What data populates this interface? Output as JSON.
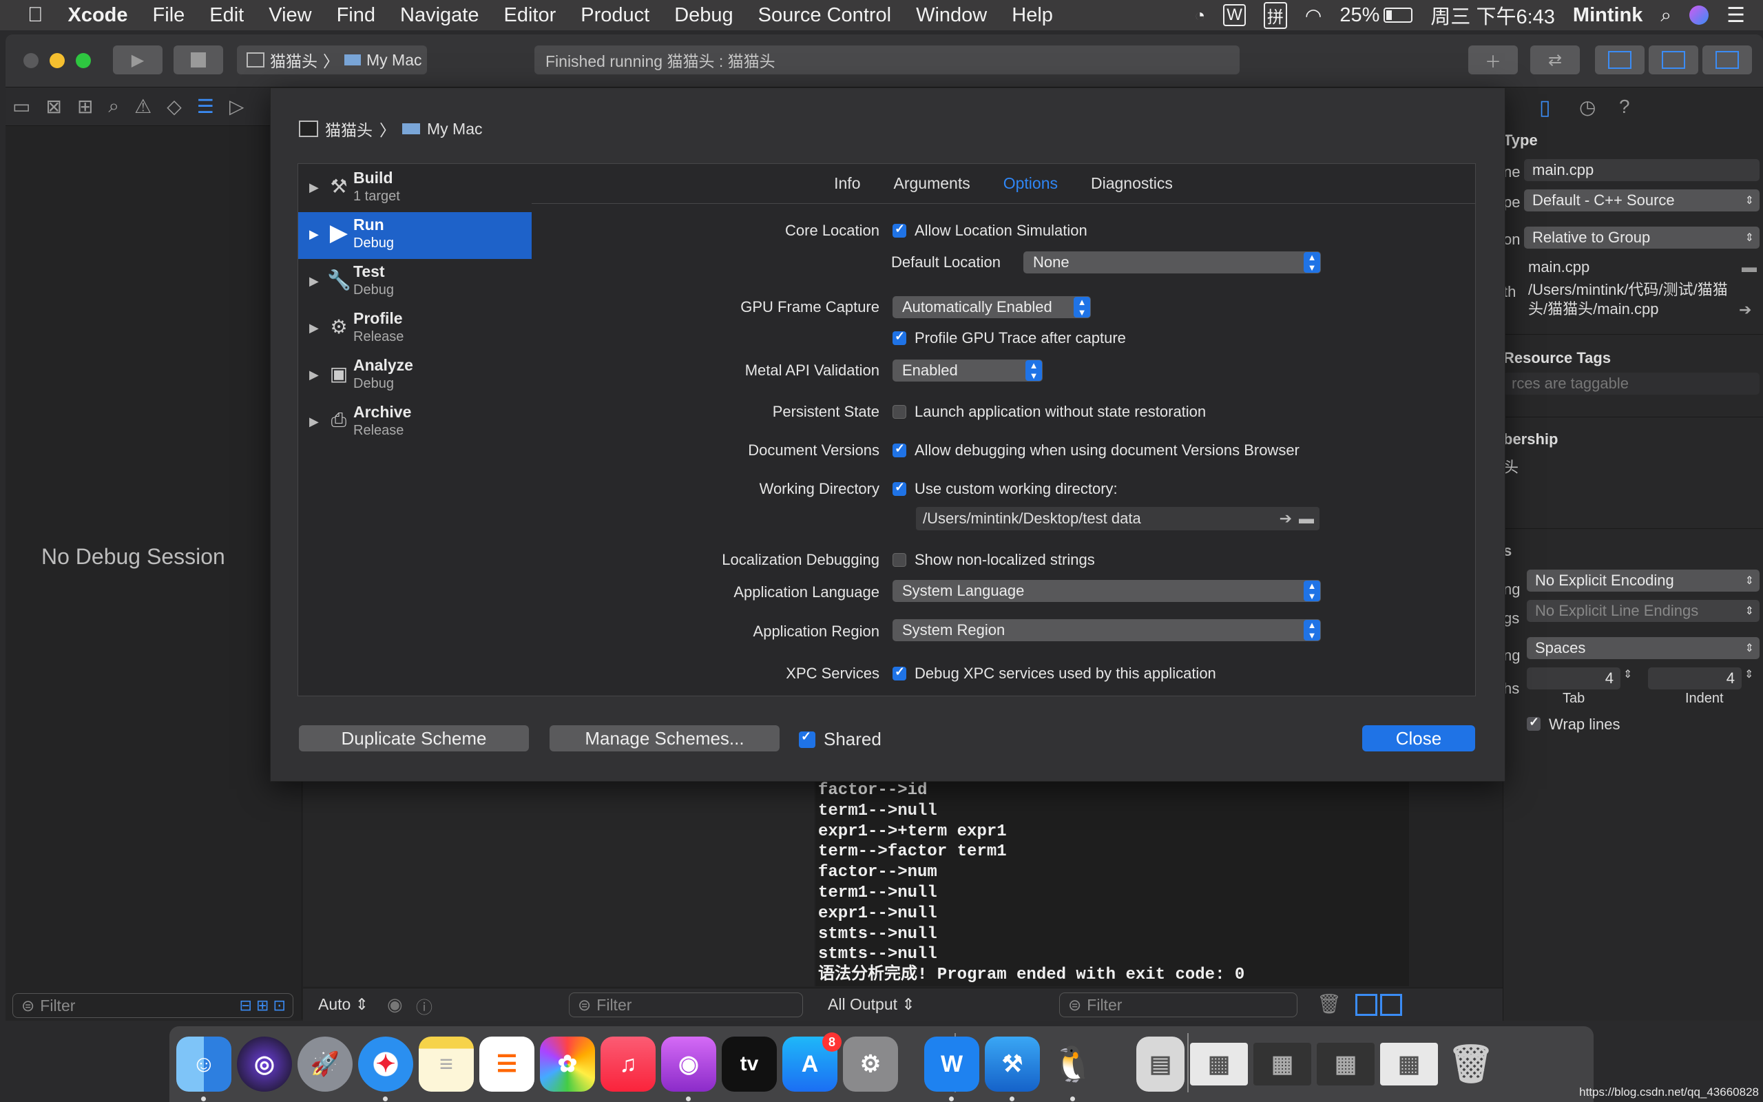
{
  "menubar": {
    "apple_icon": "apple-icon",
    "items": [
      "Xcode",
      "File",
      "Edit",
      "View",
      "Find",
      "Navigate",
      "Editor",
      "Product",
      "Debug",
      "Source Control",
      "Window",
      "Help"
    ],
    "battery": "25%",
    "clock": "周三 下午6:43",
    "user": "Mintink"
  },
  "toolbar": {
    "scheme_name": "猫猫头",
    "destination": "My Mac",
    "activity": "Finished running 猫猫头 : 猫猫头"
  },
  "left": {
    "no_debug": "No Debug Session",
    "filter_placeholder": "Filter"
  },
  "sheet": {
    "crumb_scheme": "猫猫头",
    "crumb_dest": "My Mac",
    "actions": [
      {
        "name": "Build",
        "sub": "1 target",
        "icon": "hammer-icon"
      },
      {
        "name": "Run",
        "sub": "Debug",
        "icon": "play-icon"
      },
      {
        "name": "Test",
        "sub": "Debug",
        "icon": "wrench-icon"
      },
      {
        "name": "Profile",
        "sub": "Release",
        "icon": "gauge-icon"
      },
      {
        "name": "Analyze",
        "sub": "Debug",
        "icon": "analyze-icon"
      },
      {
        "name": "Archive",
        "sub": "Release",
        "icon": "archive-icon"
      }
    ],
    "tabs": [
      "Info",
      "Arguments",
      "Options",
      "Diagnostics"
    ],
    "active_tab": "Options",
    "options": {
      "core_location_label": "Core Location",
      "allow_location": "Allow Location Simulation",
      "default_location_label": "Default Location",
      "default_location_value": "None",
      "gpu_label": "GPU Frame Capture",
      "gpu_value": "Automatically Enabled",
      "profile_gpu": "Profile GPU Trace after capture",
      "metal_label": "Metal API Validation",
      "metal_value": "Enabled",
      "persistent_label": "Persistent State",
      "persistent_text": "Launch application without state restoration",
      "docversions_label": "Document Versions",
      "docversions_text": "Allow debugging when using document Versions Browser",
      "workdir_label": "Working Directory",
      "workdir_text": "Use custom working directory:",
      "workdir_path": "/Users/mintink/Desktop/test data",
      "loc_debug_label": "Localization Debugging",
      "loc_debug_text": "Show non-localized strings",
      "app_lang_label": "Application Language",
      "app_lang_value": "System Language",
      "app_region_label": "Application Region",
      "app_region_value": "System Region",
      "xpc_label": "XPC Services",
      "xpc_text": "Debug XPC services used by this application"
    },
    "checks": {
      "allow_location": true,
      "profile_gpu": true,
      "persistent": false,
      "docversions": true,
      "workdir": true,
      "loc_debug": false,
      "xpc": true,
      "shared": true
    },
    "duplicate_button": "Duplicate Scheme",
    "manage_button": "Manage Schemes...",
    "shared_label": "Shared",
    "close_button": "Close"
  },
  "inspector": {
    "identity_header": "Type",
    "name_label": "ne",
    "name_value": "main.cpp",
    "type_label": "pe",
    "type_value": "Default - C++ Source",
    "location_label": "on",
    "location_value": "Relative to Group",
    "filename": "main.cpp",
    "path_label": "th",
    "full_path": "/Users/mintink/代码/测试/猫猫头/猫猫头/main.cpp",
    "resource_tags_header": "Resource Tags",
    "resource_tags_placeholder": "rces are taggable",
    "membership_header": "bership",
    "membership_item": "头",
    "text_settings_header": "s",
    "encoding_label": "ng",
    "encoding_value": "No Explicit Encoding",
    "line_endings_label": "gs",
    "line_endings_value": "No Explicit Line Endings",
    "indent_using_label": "ng",
    "indent_using_value": "Spaces",
    "widths_label": "hs",
    "tab_width": "4",
    "indent_width": "4",
    "tab_caption": "Tab",
    "indent_caption": "Indent",
    "wrap_lines": "Wrap lines"
  },
  "console": {
    "lines": [
      "factor-->id",
      "term1-->null",
      "expr1-->+term expr1",
      "term-->factor term1",
      "factor-->num",
      "term1-->null",
      "expr1-->null",
      "stmts-->null",
      "stmts-->null",
      "语法分析完成! Program ended with exit code: 0"
    ]
  },
  "debugbar": {
    "auto": "Auto",
    "filter_placeholder": "Filter",
    "output": "All Output",
    "filter2_placeholder": "Filter"
  },
  "dock": {
    "badge": "8",
    "watermark": "https://blog.csdn.net/qq_43660828"
  }
}
